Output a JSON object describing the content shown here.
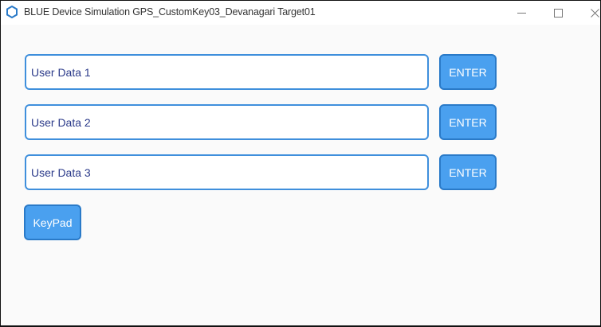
{
  "window": {
    "title": "BLUE Device Simulation GPS_CustomKey03_Devanagari Target01",
    "controls": {
      "minimize_icon": "minimize-icon",
      "maximize_icon": "maximize-icon",
      "close_icon": "close-icon"
    },
    "accent_color": "#4aa0ef",
    "border_color": "#3f8fdc"
  },
  "form": {
    "fields": [
      {
        "placeholder": "User Data 1",
        "value": ""
      },
      {
        "placeholder": "User Data 2",
        "value": ""
      },
      {
        "placeholder": "User Data 3",
        "value": ""
      }
    ],
    "enter_label": "ENTER",
    "keypad_label": "KeyPad"
  }
}
